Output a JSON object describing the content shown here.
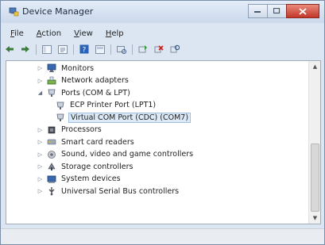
{
  "window": {
    "title": "Device Manager",
    "icons": {
      "app": "device-manager-icon",
      "minimize": "minimize-icon",
      "maximize": "maximize-icon",
      "close": "close-icon"
    }
  },
  "menu": [
    {
      "pre": "",
      "u": "F",
      "post": "ile"
    },
    {
      "pre": "",
      "u": "A",
      "post": "ction"
    },
    {
      "pre": "",
      "u": "V",
      "post": "iew"
    },
    {
      "pre": "",
      "u": "H",
      "post": "elp"
    }
  ],
  "toolbar": [
    "back-icon",
    "forward-icon",
    "show-hide-tree-icon",
    "properties-icon",
    "help-icon",
    "refresh-icon",
    "scan-hardware-icon",
    "update-driver-icon",
    "uninstall-icon",
    "disable-icon"
  ],
  "tree": [
    {
      "label": "Monitors",
      "icon": "monitor-icon",
      "expander": "collapsed",
      "level": 0
    },
    {
      "label": "Network adapters",
      "icon": "network-adapter-icon",
      "expander": "collapsed",
      "level": 0
    },
    {
      "label": "Ports (COM & LPT)",
      "icon": "port-icon",
      "expander": "expanded",
      "level": 0
    },
    {
      "label": "ECP Printer Port (LPT1)",
      "icon": "port-icon",
      "expander": "none",
      "level": 1
    },
    {
      "label": "Virtual COM Port (CDC) (COM7)",
      "icon": "port-icon",
      "expander": "none",
      "level": 1,
      "selected": true
    },
    {
      "label": "Processors",
      "icon": "processor-icon",
      "expander": "collapsed",
      "level": 0
    },
    {
      "label": "Smart card readers",
      "icon": "smart-card-icon",
      "expander": "collapsed",
      "level": 0
    },
    {
      "label": "Sound, video and game controllers",
      "icon": "sound-icon",
      "expander": "collapsed",
      "level": 0
    },
    {
      "label": "Storage controllers",
      "icon": "storage-icon",
      "expander": "collapsed",
      "level": 0
    },
    {
      "label": "System devices",
      "icon": "system-device-icon",
      "expander": "collapsed",
      "level": 0
    },
    {
      "label": "Universal Serial Bus controllers",
      "icon": "usb-icon",
      "expander": "collapsed",
      "level": 0
    }
  ],
  "colors": {
    "selection": "#dce9f7",
    "selection_border": "#9fbfe0",
    "close_button": "#c2372a"
  }
}
